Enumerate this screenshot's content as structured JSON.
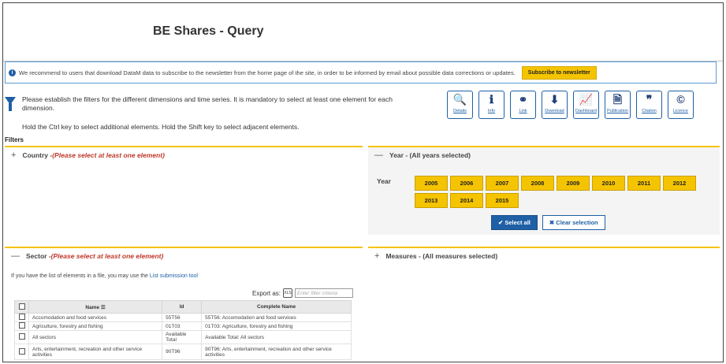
{
  "title": "BE Shares - Query",
  "notice": {
    "icon": "info-icon",
    "text": "We recommend to users that download DataM data to subscribe to the newsletter from the home page of the site, in order to be informed by email about possible data corrections or updates.",
    "button": "Subscribe to newsletter"
  },
  "instructions": {
    "line1": "Please establish the filters for the different dimensions and time series. It is mandatory to select at least one element for each dimension.",
    "line2": "Hold the Ctrl key to select additional elements. Hold the Shift key to select adjacent elements."
  },
  "toolbar": [
    {
      "label": "Details",
      "glyph": "🔍",
      "icon": "search-icon"
    },
    {
      "label": "Info",
      "glyph": "ℹ",
      "icon": "info-icon"
    },
    {
      "label": "Link",
      "glyph": "⚭",
      "icon": "link-icon"
    },
    {
      "label": "Download",
      "glyph": "⬇",
      "icon": "download-icon"
    },
    {
      "label": "Dashboard",
      "glyph": "📈",
      "icon": "dashboard-icon"
    },
    {
      "label": "Publication",
      "glyph": "🗎",
      "icon": "publication-icon"
    },
    {
      "label": "Citation",
      "glyph": "❞",
      "icon": "citation-icon"
    },
    {
      "label": "Licence",
      "glyph": "©",
      "icon": "licence-icon"
    }
  ],
  "filters_label": "Filters",
  "country": {
    "symbol": "+",
    "label": "Country - ",
    "warning": "(Please select at least one element)"
  },
  "year": {
    "symbol": "—",
    "label": "Year - (All years selected)",
    "row_label": "Year",
    "values": [
      "2005",
      "2006",
      "2007",
      "2008",
      "2009",
      "2010",
      "2011",
      "2012",
      "2013",
      "2014",
      "2015"
    ],
    "select_all": "Select all",
    "clear": "Clear selection"
  },
  "sector": {
    "symbol": "—",
    "label": "Sector - ",
    "warning": "(Please select at least one element)",
    "tip": "If you have the list of elements in a file, you may use the",
    "tip_link": "List submission tool",
    "export_label": "Export as:",
    "filter_placeholder": "Enter filter criteria",
    "columns": [
      "Name",
      "Id",
      "Complete Name"
    ],
    "rows": [
      {
        "name": "Accomodation and food services",
        "id": "55T56",
        "complete": "55T56: Accomodation and food services"
      },
      {
        "name": "Agriculture, forestry and fishing",
        "id": "01T03",
        "complete": "01T03: Agriculture, forestry and fishing"
      },
      {
        "name": "All sectors",
        "id": "Available Total",
        "complete": "Available Total: All sectors"
      },
      {
        "name": "Arts, entertainment, recreation and other service activities",
        "id": "90T96",
        "complete": "90T96: Arts, entertainment, recreation and other service activities"
      }
    ]
  },
  "measures": {
    "symbol": "+",
    "label": "Measures - (All measures selected)"
  },
  "colors": {
    "accent": "#f5c400",
    "primary": "#1f5fa6",
    "warning": "#c0392b"
  }
}
